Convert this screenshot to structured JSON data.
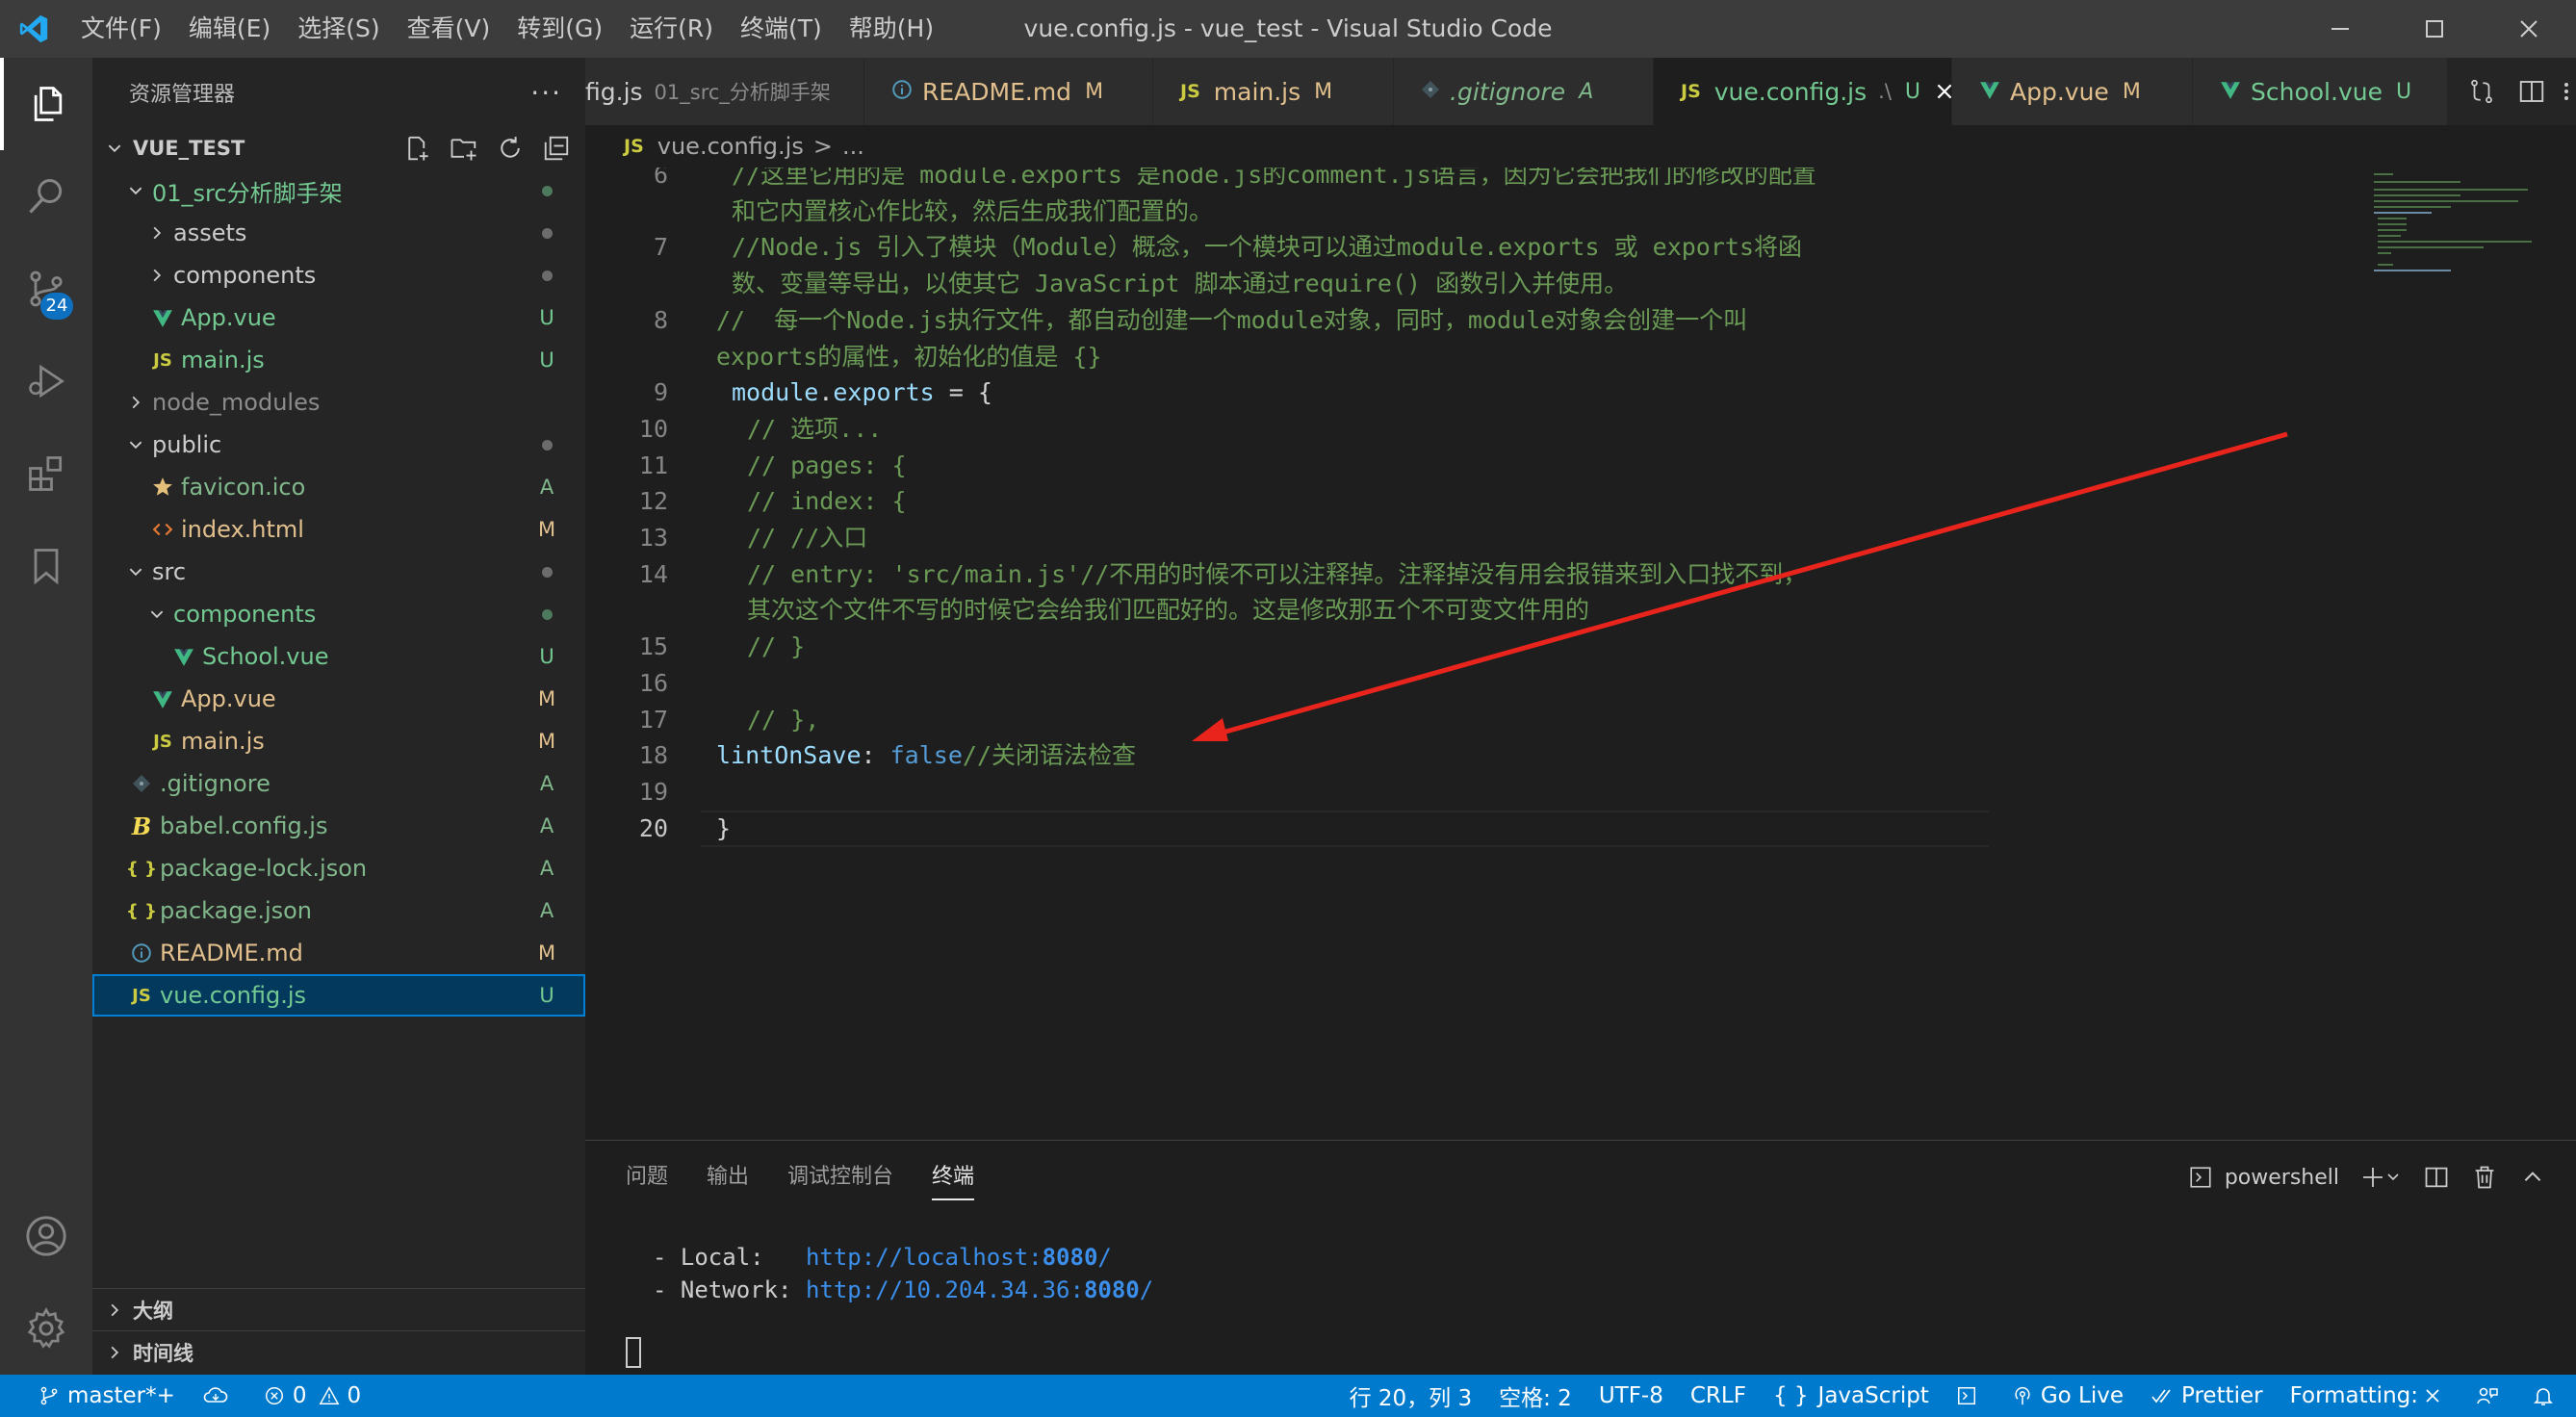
{
  "window": {
    "title": "vue.config.js - vue_test - Visual Studio Code"
  },
  "menu": [
    "文件(F)",
    "编辑(E)",
    "选择(S)",
    "查看(V)",
    "转到(G)",
    "运行(R)",
    "终端(T)",
    "帮助(H)"
  ],
  "activity_bar": {
    "scm_badge": "24"
  },
  "sidebar": {
    "title": "资源管理器",
    "more": "···",
    "workspace": "VUE_TEST",
    "tree": [
      {
        "name": "01_src分析脚手架",
        "type": "folder",
        "open": true,
        "depth": 1,
        "status": "",
        "dot": true,
        "color": "#73c991"
      },
      {
        "name": "assets",
        "type": "folder",
        "open": false,
        "depth": 2,
        "status": "",
        "dot": true,
        "color": "#cccccc"
      },
      {
        "name": "components",
        "type": "folder",
        "open": false,
        "depth": 2,
        "status": "",
        "dot": true,
        "color": "#cccccc"
      },
      {
        "name": "App.vue",
        "type": "vue",
        "depth": 2,
        "status": "U",
        "color": "#73c991"
      },
      {
        "name": "main.js",
        "type": "js",
        "depth": 2,
        "status": "U",
        "color": "#73c991"
      },
      {
        "name": "node_modules",
        "type": "folder",
        "open": false,
        "depth": 1,
        "status": "",
        "color": "#8c8c8c"
      },
      {
        "name": "public",
        "type": "folder",
        "open": true,
        "depth": 1,
        "status": "",
        "dot": true,
        "color": "#cccccc"
      },
      {
        "name": "favicon.ico",
        "type": "star",
        "depth": 2,
        "status": "A",
        "color": "#81b88b"
      },
      {
        "name": "index.html",
        "type": "html",
        "depth": 2,
        "status": "M",
        "color": "#e2c08d"
      },
      {
        "name": "src",
        "type": "folder",
        "open": true,
        "depth": 1,
        "status": "",
        "dot": true,
        "color": "#cccccc"
      },
      {
        "name": "components",
        "type": "folder",
        "open": true,
        "depth": 2,
        "status": "",
        "dot": true,
        "color": "#73c991"
      },
      {
        "name": "School.vue",
        "type": "vue",
        "depth": 3,
        "status": "U",
        "color": "#73c991"
      },
      {
        "name": "App.vue",
        "type": "vue",
        "depth": 2,
        "status": "M",
        "color": "#e2c08d"
      },
      {
        "name": "main.js",
        "type": "js",
        "depth": 2,
        "status": "M",
        "color": "#e2c08d"
      },
      {
        "name": ".gitignore",
        "type": "git",
        "depth": 1,
        "status": "A",
        "color": "#81b88b"
      },
      {
        "name": "babel.config.js",
        "type": "babel",
        "depth": 1,
        "status": "A",
        "color": "#81b88b"
      },
      {
        "name": "package-lock.json",
        "type": "json",
        "depth": 1,
        "status": "A",
        "color": "#81b88b"
      },
      {
        "name": "package.json",
        "type": "json",
        "depth": 1,
        "status": "A",
        "color": "#81b88b"
      },
      {
        "name": "README.md",
        "type": "info",
        "depth": 1,
        "status": "M",
        "color": "#e2c08d"
      },
      {
        "name": "vue.config.js",
        "type": "js",
        "depth": 1,
        "status": "U",
        "color": "#73c991",
        "selected": true
      }
    ],
    "sections": [
      "大纲",
      "时间线"
    ]
  },
  "tabs": [
    {
      "label": "fig.js",
      "desc": "01_src_分析脚手架",
      "status": "",
      "icon": "",
      "color": "#cccccc"
    },
    {
      "label": "README.md",
      "desc": "",
      "status": "M",
      "icon": "info",
      "color": "#e2c08d"
    },
    {
      "label": "main.js",
      "desc": "",
      "status": "M",
      "icon": "JS",
      "color": "#e2c08d"
    },
    {
      "label": ".gitignore",
      "desc": "",
      "status": "A",
      "icon": "git",
      "color": "#81b88b"
    },
    {
      "label": "vue.config.js",
      "desc": ".\\",
      "status": "U",
      "icon": "JS",
      "color": "#73c991",
      "active": true
    },
    {
      "label": "App.vue",
      "desc": "",
      "status": "M",
      "icon": "vue",
      "color": "#e2c08d"
    },
    {
      "label": "School.vue",
      "desc": "",
      "status": "U",
      "icon": "vue",
      "color": "#73c991"
    }
  ],
  "breadcrumb": {
    "icon": "JS",
    "file": "vue.config.js",
    "sep": ">",
    "rest": "..."
  },
  "code": [
    {
      "ln": "6",
      "indent": 1,
      "tokens": [
        [
          "cm",
          "//这里它用的是 module.exports 是node.js的comment.js语言，因为它会把我们的修改的配置"
        ]
      ]
    },
    {
      "ln": "",
      "indent": 1,
      "tokens": [
        [
          "cm",
          "和它内置核心作比较，然后生成我们配置的。"
        ]
      ]
    },
    {
      "ln": "7",
      "indent": 1,
      "tokens": [
        [
          "cm",
          "//Node.js 引入了模块（Module）概念，一个模块可以通过module.exports 或 exports将函"
        ]
      ]
    },
    {
      "ln": "",
      "indent": 1,
      "tokens": [
        [
          "cm",
          "数、变量等导出，以使其它 JavaScript 脚本通过require() 函数引入并使用。"
        ]
      ]
    },
    {
      "ln": "8",
      "indent": 0,
      "tokens": [
        [
          "cm",
          "//  每一个Node.js执行文件，都自动创建一个module对象，同时，module对象会创建一个叫"
        ]
      ]
    },
    {
      "ln": "",
      "indent": 0,
      "tokens": [
        [
          "cm",
          "exports的属性，初始化的值是 {}"
        ]
      ]
    },
    {
      "ln": "9",
      "indent": 1,
      "tokens": [
        [
          "vr",
          "module"
        ],
        [
          "pl",
          "."
        ],
        [
          "vr",
          "exports"
        ],
        [
          "pl",
          " = {"
        ]
      ]
    },
    {
      "ln": "10",
      "indent": 2,
      "tokens": [
        [
          "cm",
          "// 选项..."
        ]
      ]
    },
    {
      "ln": "11",
      "indent": 2,
      "tokens": [
        [
          "cm",
          "// pages: {"
        ]
      ]
    },
    {
      "ln": "12",
      "indent": 2,
      "tokens": [
        [
          "cm",
          "// index: {"
        ]
      ]
    },
    {
      "ln": "13",
      "indent": 2,
      "tokens": [
        [
          "cm",
          "// //入口"
        ]
      ]
    },
    {
      "ln": "14",
      "indent": 2,
      "tokens": [
        [
          "cm",
          "// entry: 'src/main.js'//不用的时候不可以注释掉。注释掉没有用会报错来到入口找不到，"
        ]
      ]
    },
    {
      "ln": "",
      "indent": 2,
      "tokens": [
        [
          "cm",
          "其次这个文件不写的时候它会给我们匹配好的。这是修改那五个不可变文件用的"
        ]
      ]
    },
    {
      "ln": "15",
      "indent": 2,
      "tokens": [
        [
          "cm",
          "// }"
        ]
      ]
    },
    {
      "ln": "16",
      "indent": 0,
      "tokens": []
    },
    {
      "ln": "17",
      "indent": 2,
      "tokens": [
        [
          "cm",
          "// },"
        ]
      ]
    },
    {
      "ln": "18",
      "indent": 0,
      "tokens": [
        [
          "vr",
          "lintOnSave"
        ],
        [
          "pl",
          ": "
        ],
        [
          "kw",
          "false"
        ],
        [
          "cm",
          "//关闭语法检查"
        ]
      ]
    },
    {
      "ln": "19",
      "indent": 0,
      "tokens": []
    },
    {
      "ln": "20",
      "indent": 0,
      "tokens": [
        [
          "pl",
          "}"
        ]
      ],
      "active": true
    }
  ],
  "panel": {
    "tabs": [
      "问题",
      "输出",
      "调试控制台",
      "终端"
    ],
    "active_tab": "终端",
    "shell": "powershell",
    "terminal": [
      {
        "label": "- Local:   ",
        "url": "http://localhost:",
        "port": "8080",
        "tail": "/"
      },
      {
        "label": "- Network: ",
        "url": "http://10.204.34.36:",
        "port": "8080",
        "tail": "/"
      }
    ]
  },
  "status_bar": {
    "branch": "master*+",
    "errors": "0",
    "warnings": "0",
    "position": "行 20，列 3",
    "spaces": "空格: 2",
    "encoding": "UTF-8",
    "eol": "CRLF",
    "language_brace": "{ }",
    "language": "JavaScript",
    "golive": "Go Live",
    "prettier": "Prettier",
    "formatting": "Formatting: "
  },
  "colors": {
    "accent": "#007acc",
    "comment": "#6a9955",
    "variable": "#9cdcfe",
    "keyword": "#569cd6",
    "annotation_arrow": "#e8241c"
  }
}
